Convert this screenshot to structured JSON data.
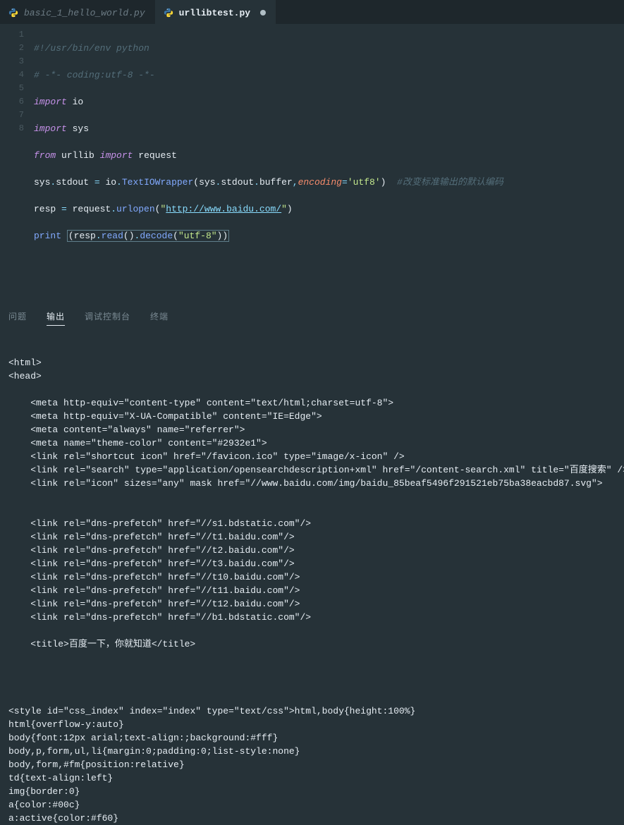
{
  "tabs": [
    {
      "label": "basic_1_hello_world.py",
      "active": false
    },
    {
      "label": "urllibtest.py",
      "active": true,
      "dirty": true
    }
  ],
  "gutter": [
    "1",
    "2",
    "3",
    "4",
    "5",
    "6",
    "7",
    "8"
  ],
  "code": {
    "l1": "#!/usr/bin/env python",
    "l2": "# -*- coding:utf-8 -*-",
    "l3_kw": "import",
    "l3_mod": "io",
    "l4_kw": "import",
    "l4_mod": "sys",
    "l5_from": "from",
    "l5_pkg": "urllib",
    "l5_imp": "import",
    "l5_mod": "request",
    "l6_a": "sys",
    "l6_dot1": ".",
    "l6_b": "stdout",
    "l6_eq": " = ",
    "l6_c": "io",
    "l6_dot2": ".",
    "l6_fn": "TextIOWrapper",
    "l6_pL": "(",
    "l6_arg": "sys",
    "l6_d3": ".",
    "l6_arg2": "stdout",
    "l6_d4": ".",
    "l6_arg3": "buffer",
    "l6_comma": ",",
    "l6_kw": "encoding",
    "l6_eq2": "=",
    "l6_str": "'utf8'",
    "l6_pR": ")",
    "l6_cmt": "  #改变标准输出的默认编码",
    "l7_a": "resp",
    "l7_eq": " = ",
    "l7_b": "request",
    "l7_dot": ".",
    "l7_fn": "urlopen",
    "l7_pL": "(",
    "l7_q1": "\"",
    "l7_url": "http://www.baidu.com/",
    "l7_q2": "\"",
    "l7_pR": ")",
    "l8_fn": "print",
    "l8_sp": " ",
    "l8_pL": "(",
    "l8_a": "resp",
    "l8_d1": ".",
    "l8_b": "read",
    "l8_p2": "()",
    "l8_d2": ".",
    "l8_c": "decode",
    "l8_p3L": "(",
    "l8_str": "\"utf-8\"",
    "l8_p3R": ")",
    "l8_pR": ")"
  },
  "panel_tabs": {
    "problems": "问题",
    "output": "输出",
    "debug": "调试控制台",
    "terminal": "终端"
  },
  "output": "<html>\n<head>\n    \n    <meta http-equiv=\"content-type\" content=\"text/html;charset=utf-8\">\n    <meta http-equiv=\"X-UA-Compatible\" content=\"IE=Edge\">\n    <meta content=\"always\" name=\"referrer\">\n    <meta name=\"theme-color\" content=\"#2932e1\">\n    <link rel=\"shortcut icon\" href=\"/favicon.ico\" type=\"image/x-icon\" />\n    <link rel=\"search\" type=\"application/opensearchdescription+xml\" href=\"/content-search.xml\" title=\"百度搜索\" />\n    <link rel=\"icon\" sizes=\"any\" mask href=\"//www.baidu.com/img/baidu_85beaf5496f291521eb75ba38eacbd87.svg\">\n\n    \n    <link rel=\"dns-prefetch\" href=\"//s1.bdstatic.com\"/>\n    <link rel=\"dns-prefetch\" href=\"//t1.baidu.com\"/>\n    <link rel=\"dns-prefetch\" href=\"//t2.baidu.com\"/>\n    <link rel=\"dns-prefetch\" href=\"//t3.baidu.com\"/>\n    <link rel=\"dns-prefetch\" href=\"//t10.baidu.com\"/>\n    <link rel=\"dns-prefetch\" href=\"//t11.baidu.com\"/>\n    <link rel=\"dns-prefetch\" href=\"//t12.baidu.com\"/>\n    <link rel=\"dns-prefetch\" href=\"//b1.bdstatic.com\"/>\n    \n    <title>百度一下，你就知道</title>\n    \n\n\n\n<style id=\"css_index\" index=\"index\" type=\"text/css\">html,body{height:100%}\nhtml{overflow-y:auto}\nbody{font:12px arial;text-align:;background:#fff}\nbody,p,form,ul,li{margin:0;padding:0;list-style:none}\nbody,form,#fm{position:relative}\ntd{text-align:left}\nimg{border:0}\na{color:#00c}\na:active{color:#f60}"
}
